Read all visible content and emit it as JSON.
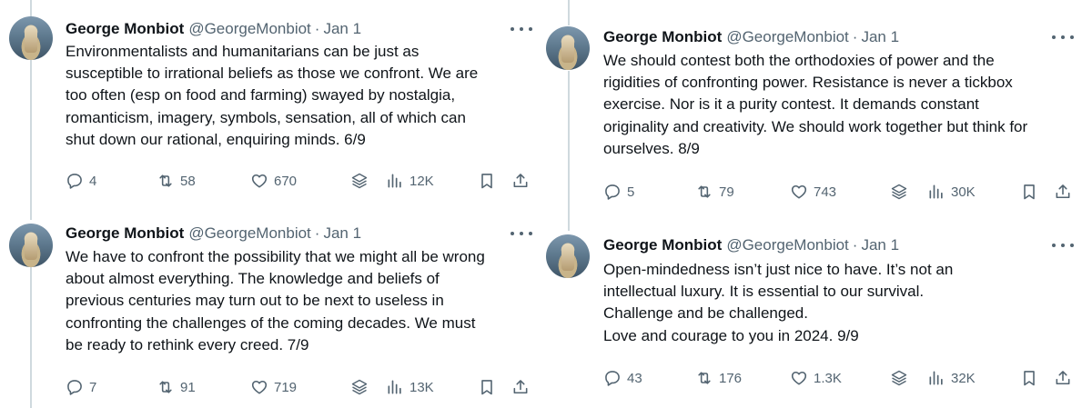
{
  "tweets": [
    {
      "author": "George Monbiot",
      "handle": "@GeorgeMonbiot",
      "separator": "·",
      "date": "Jan 1",
      "lines": [
        "Environmentalists and humanitarians can be just as",
        "susceptible to irrational beliefs as those we confront. We are",
        "too often (esp on food and farming) swayed by nostalgia,",
        "romanticism, imagery, symbols, sensation, all of which can",
        "shut down our rational, enquiring minds. 6/9"
      ],
      "replies": "4",
      "reposts": "58",
      "likes": "670",
      "views": "12K"
    },
    {
      "author": "George Monbiot",
      "handle": "@GeorgeMonbiot",
      "separator": "·",
      "date": "Jan 1",
      "lines": [
        "We have to confront the possibility that we might all be wrong",
        "about almost everything. The knowledge and beliefs of",
        "previous centuries may turn out to be next to useless in",
        "confronting the challenges of the coming decades. We must",
        "be ready to rethink every creed. 7/9"
      ],
      "replies": "7",
      "reposts": "91",
      "likes": "719",
      "views": "13K"
    },
    {
      "author": "George Monbiot",
      "handle": "@GeorgeMonbiot",
      "separator": "·",
      "date": "Jan 1",
      "lines": [
        "We should contest both the orthodoxies of power and the",
        "rigidities of confronting power. Resistance is never a tickbox",
        "exercise. Nor is it a purity contest. It demands constant",
        "originality and creativity. We should work together but think for",
        "ourselves. 8/9"
      ],
      "replies": "5",
      "reposts": "79",
      "likes": "743",
      "views": "30K"
    },
    {
      "author": "George Monbiot",
      "handle": "@GeorgeMonbiot",
      "separator": "·",
      "date": "Jan 1",
      "lines": [
        "Open-mindedness isn’t just nice to have. It’s not an",
        "intellectual luxury. It is essential to our survival.",
        "Challenge and be challenged.",
        "Love and courage to you in 2024. 9/9"
      ],
      "replies": "43",
      "reposts": "176",
      "likes": "1.3K",
      "views": "32K"
    }
  ],
  "icons": {
    "reply": "reply-icon",
    "repost": "repost-icon",
    "like": "like-icon",
    "grok": "layers-icon",
    "views": "views-icon",
    "bookmark": "bookmark-icon",
    "share": "share-icon",
    "more": "more-icon"
  },
  "colors": {
    "text": "#0f1419",
    "secondary": "#536471",
    "thread_line": "#cfd9de"
  }
}
